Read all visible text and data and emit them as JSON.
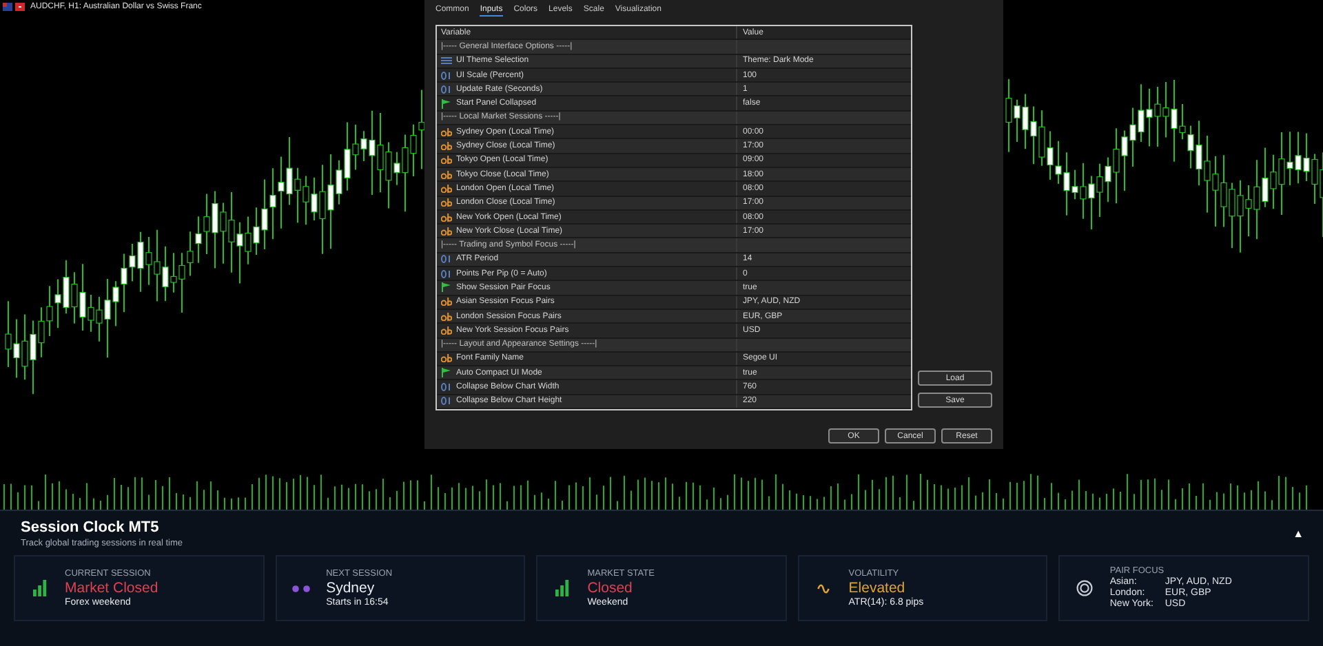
{
  "chart": {
    "title": "AUDCHF, H1: Australian Dollar vs Swiss Franc"
  },
  "dialog": {
    "tabs": [
      {
        "label": "Common",
        "selected": false
      },
      {
        "label": "Inputs",
        "selected": true
      },
      {
        "label": "Colors",
        "selected": false
      },
      {
        "label": "Levels",
        "selected": false
      },
      {
        "label": "Scale",
        "selected": false
      },
      {
        "label": "Visualization",
        "selected": false
      }
    ],
    "columns": [
      "Variable",
      "Value"
    ],
    "rows": [
      {
        "kind": "group",
        "name": "|----- General Interface Options -----|"
      },
      {
        "kind": "enum",
        "name": "UI Theme Selection",
        "value": "Theme: Dark Mode"
      },
      {
        "kind": "number",
        "name": "UI Scale (Percent)",
        "value": "100"
      },
      {
        "kind": "number",
        "name": "Update Rate (Seconds)",
        "value": "1"
      },
      {
        "kind": "bool",
        "name": "Start Panel Collapsed",
        "value": "false"
      },
      {
        "kind": "group",
        "name": "|----- Local Market Sessions -----|"
      },
      {
        "kind": "text",
        "name": "Sydney Open (Local Time)",
        "value": "00:00"
      },
      {
        "kind": "text",
        "name": "Sydney Close (Local Time)",
        "value": "17:00"
      },
      {
        "kind": "text",
        "name": "Tokyo Open (Local Time)",
        "value": "09:00"
      },
      {
        "kind": "text",
        "name": "Tokyo Close (Local Time)",
        "value": "18:00"
      },
      {
        "kind": "text",
        "name": "London Open (Local Time)",
        "value": "08:00"
      },
      {
        "kind": "text",
        "name": "London Close (Local Time)",
        "value": "17:00"
      },
      {
        "kind": "text",
        "name": "New York Open (Local Time)",
        "value": "08:00"
      },
      {
        "kind": "text",
        "name": "New York Close (Local Time)",
        "value": "17:00"
      },
      {
        "kind": "group",
        "name": "|----- Trading and Symbol Focus -----|"
      },
      {
        "kind": "number",
        "name": "ATR Period",
        "value": "14"
      },
      {
        "kind": "number",
        "name": "Points Per Pip (0 = Auto)",
        "value": "0"
      },
      {
        "kind": "bool",
        "name": "Show Session Pair Focus",
        "value": "true"
      },
      {
        "kind": "text",
        "name": "Asian Session Focus Pairs",
        "value": "JPY, AUD, NZD"
      },
      {
        "kind": "text",
        "name": "London Session Focus Pairs",
        "value": "EUR, GBP"
      },
      {
        "kind": "text",
        "name": "New York Session Focus Pairs",
        "value": "USD"
      },
      {
        "kind": "group",
        "name": "|----- Layout and Appearance Settings -----|"
      },
      {
        "kind": "text",
        "name": "Font Family Name",
        "value": "Segoe UI"
      },
      {
        "kind": "bool",
        "name": "Auto Compact UI Mode",
        "value": "true"
      },
      {
        "kind": "number",
        "name": "Collapse Below Chart Width",
        "value": "760"
      },
      {
        "kind": "number",
        "name": "Collapse Below Chart Height",
        "value": "220"
      }
    ],
    "side_buttons": [
      "Load",
      "Save"
    ],
    "buttons": [
      "OK",
      "Cancel",
      "Reset"
    ]
  },
  "panel": {
    "title": "Session Clock MT5",
    "subtitle": "Track global trading sessions in real time",
    "collapse": "▲",
    "cards": [
      {
        "kind": "current_session",
        "label": "CURRENT SESSION",
        "value": "Market Closed",
        "color": "#e0404f",
        "detail": "Forex weekend"
      },
      {
        "kind": "next_session",
        "label": "NEXT SESSION",
        "value": "Sydney",
        "color": "#e8ecf2",
        "detail": "Starts in 16:54"
      },
      {
        "kind": "market_state",
        "label": "MARKET STATE",
        "value": "Closed",
        "color": "#e0404f",
        "detail": "Weekend"
      },
      {
        "kind": "volatility",
        "label": "VOLATILITY",
        "value": "Elevated",
        "color": "#e0a530",
        "detail": "ATR(14): 6.8 pips"
      },
      {
        "kind": "pair_focus",
        "label": "PAIR FOCUS",
        "pairs": [
          {
            "session": "Asian:",
            "symbols": "JPY, AUD, NZD"
          },
          {
            "session": "London:",
            "symbols": "EUR, GBP"
          },
          {
            "session": "New York:",
            "symbols": "USD"
          }
        ]
      }
    ]
  }
}
